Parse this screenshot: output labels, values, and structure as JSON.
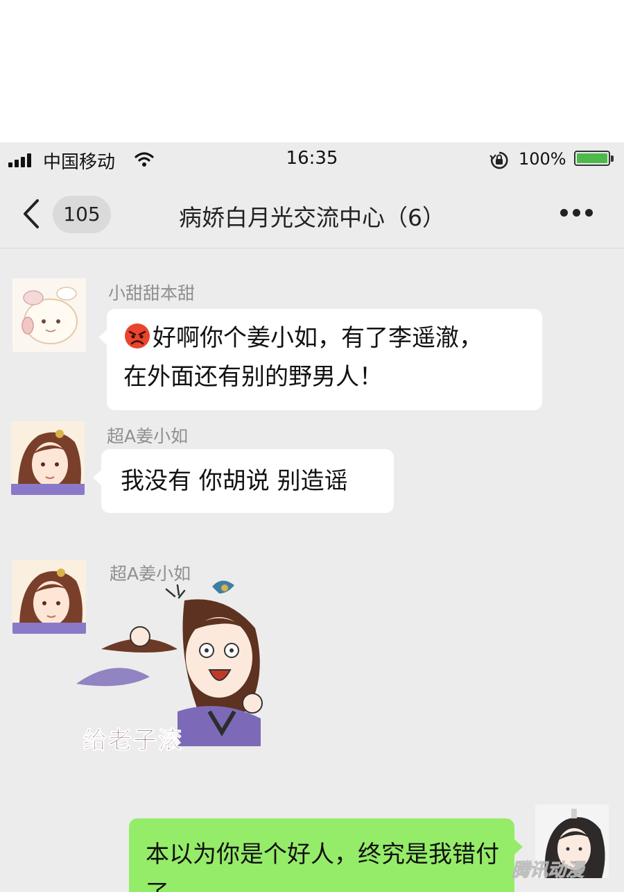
{
  "status_bar": {
    "carrier": "中国移动",
    "time": "16:35",
    "battery": "100%",
    "battery_level": 1.0
  },
  "nav": {
    "unread_count": "105",
    "title": "病娇白月光交流中心（6）"
  },
  "messages": [
    {
      "sender": "小甜甜本甜",
      "emoji": "angry-face",
      "lines": [
        "好啊你个姜小如，有了李遥澈，",
        "在外面还有别的野男人！"
      ]
    },
    {
      "sender": "超A姜小如",
      "lines": [
        "我没有 你胡说 别造谣"
      ]
    },
    {
      "sender": "超A姜小如",
      "sticker_caption": "给老子滚"
    },
    {
      "sender": "",
      "lines": [
        "本以为你是个好人，终究是我错付",
        "了。"
      ]
    }
  ],
  "watermark": "腾讯动漫",
  "colors": {
    "chat_bg": "#ececec",
    "sent_bubble": "#95ec69",
    "received_bubble": "#ffffff",
    "battery": "#4cb94a"
  }
}
